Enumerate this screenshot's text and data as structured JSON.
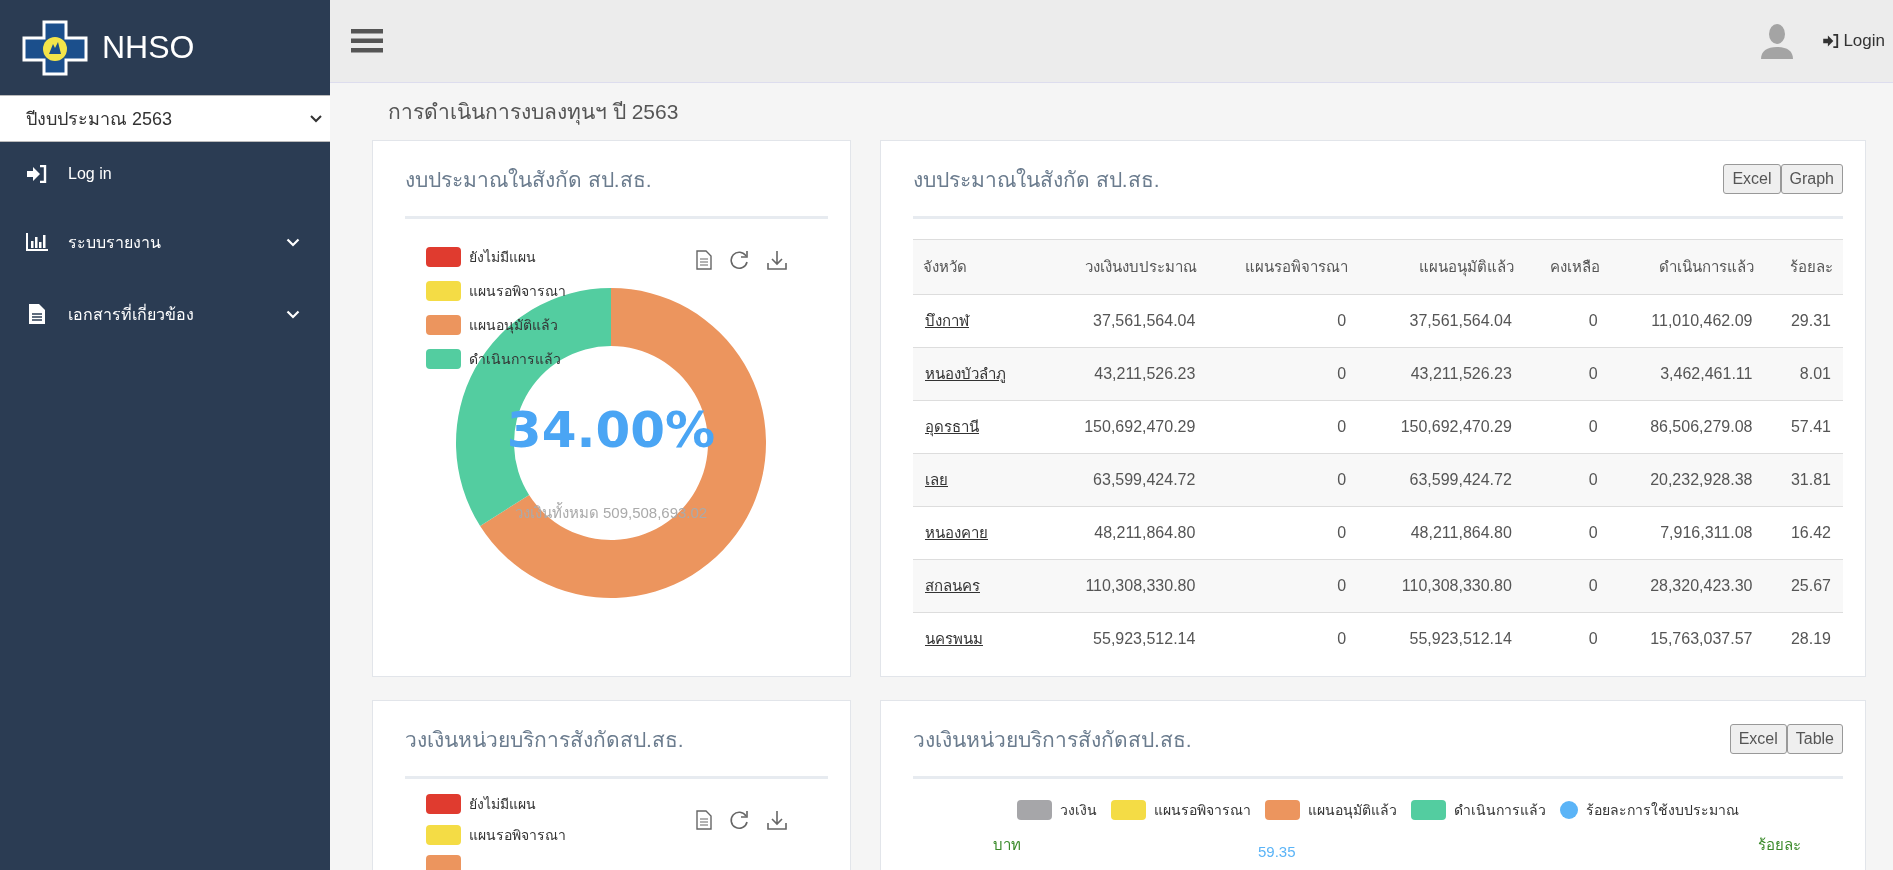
{
  "sidebar": {
    "logo_text": "NHSO",
    "year_select": {
      "value": "ปีงบประมาณ 2563"
    },
    "items": [
      {
        "label": "Log in",
        "kind": "link"
      },
      {
        "label": "ระบบรายงาน",
        "kind": "submenu"
      },
      {
        "label": "เอกสารที่เกี่ยวข้อง",
        "kind": "submenu"
      }
    ]
  },
  "topbar": {
    "login": "Login"
  },
  "page_title": "การดำเนินการงบลงทุนฯ ปี 2563",
  "budget_donut_card": {
    "title": "งบประมาณในสังกัด สป.สธ.",
    "legend": [
      {
        "label": "ยังไม่มีแผน",
        "color": "#e03b2f"
      },
      {
        "label": "แผนรอพิจารณา",
        "color": "#f4dc45"
      },
      {
        "label": "แผนอนุมัติแล้ว",
        "color": "#ec955e"
      },
      {
        "label": "ดำเนินการแล้ว",
        "color": "#53cda0"
      }
    ],
    "center_value": "34.00%",
    "total_label": "วงเงินทั้งหมด 509,508,693.02",
    "chart_data": {
      "type": "donut",
      "values": [
        0,
        0,
        66,
        34
      ]
    }
  },
  "budget_table_card": {
    "title": "งบประมาณในสังกัด สป.สธ.",
    "buttons": [
      "Excel",
      "Graph"
    ],
    "columns": [
      "จังหวัด",
      "วงเงินงบประมาณ",
      "แผนรอพิจารณา",
      "แผนอนุมัติแล้ว",
      "คงเหลือ",
      "ดำเนินการแล้ว",
      "ร้อยละ"
    ],
    "rows": [
      [
        "บึงกาฬ",
        "37,561,564.04",
        "0",
        "37,561,564.04",
        "0",
        "11,010,462.09",
        "29.31"
      ],
      [
        "หนองบัวลำภู",
        "43,211,526.23",
        "0",
        "43,211,526.23",
        "0",
        "3,462,461.11",
        "8.01"
      ],
      [
        "อุดรธานี",
        "150,692,470.29",
        "0",
        "150,692,470.29",
        "0",
        "86,506,279.08",
        "57.41"
      ],
      [
        "เลย",
        "63,599,424.72",
        "0",
        "63,599,424.72",
        "0",
        "20,232,928.38",
        "31.81"
      ],
      [
        "หนองคาย",
        "48,211,864.80",
        "0",
        "48,211,864.80",
        "0",
        "7,916,311.08",
        "16.42"
      ],
      [
        "สกลนคร",
        "110,308,330.80",
        "0",
        "110,308,330.80",
        "0",
        "28,320,423.30",
        "25.67"
      ],
      [
        "นครพนม",
        "55,923,512.14",
        "0",
        "55,923,512.14",
        "0",
        "15,763,037.57",
        "28.19"
      ]
    ]
  },
  "service_donut_card": {
    "title": "วงเงินหน่วยบริการสังกัดสป.สธ.",
    "legend": [
      {
        "label": "ยังไม่มีแผน",
        "color": "#e03b2f"
      },
      {
        "label": "แผนรอพิจารณา",
        "color": "#f4dc45"
      },
      {
        "color": "#ec955e"
      }
    ]
  },
  "service_chart_card": {
    "title": "วงเงินหน่วยบริการสังกัดสป.สธ.",
    "buttons": [
      "Excel",
      "Table"
    ],
    "legend": [
      {
        "label": "วงเงิน",
        "color": "#a6a6a9",
        "kind": "bar"
      },
      {
        "label": "แผนรอพิจารณา",
        "color": "#f4dc45",
        "kind": "bar"
      },
      {
        "label": "แผนอนุมัติแล้ว",
        "color": "#ec955e",
        "kind": "bar"
      },
      {
        "label": "ดำเนินการแล้ว",
        "color": "#53cda0",
        "kind": "bar"
      },
      {
        "label": "ร้อยละการใช้งบประมาณ",
        "color": "#5bb4f7",
        "kind": "dot"
      }
    ],
    "left_axis_label": "บาท",
    "data_label": "59.35",
    "right_axis_label": "ร้อยละ"
  }
}
